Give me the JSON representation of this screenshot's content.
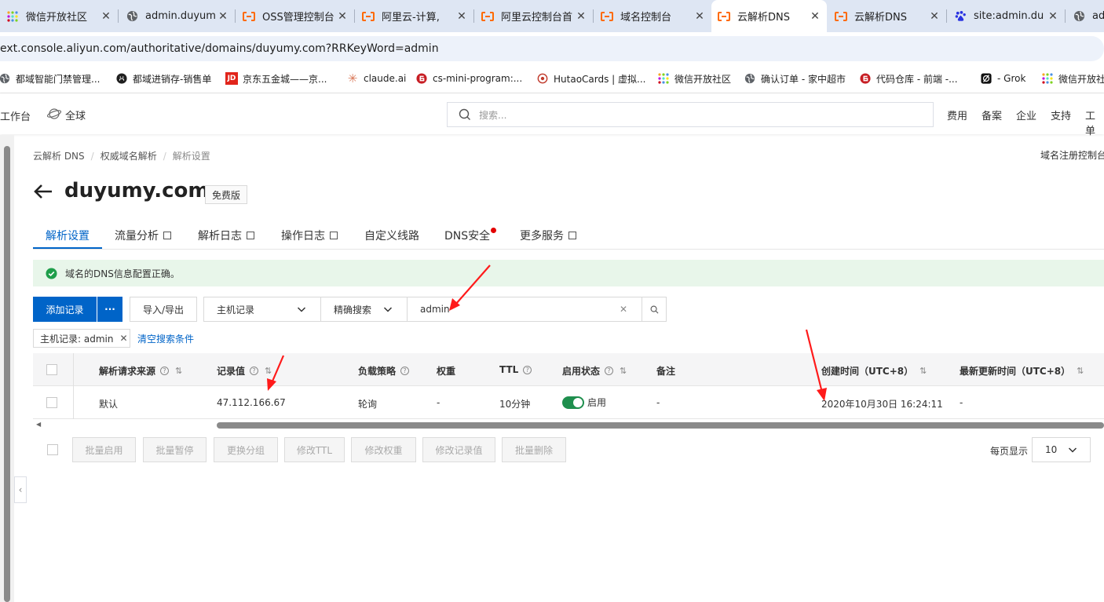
{
  "browser": {
    "tabs": [
      {
        "label": "微信开放社区",
        "icon": "wechat-dots-icon"
      },
      {
        "label": "admin.duyum",
        "icon": "globe-icon"
      },
      {
        "label": "OSS管理控制台",
        "icon": "aliyun-icon"
      },
      {
        "label": "阿里云-计算,",
        "icon": "aliyun-icon"
      },
      {
        "label": "阿里云控制台首",
        "icon": "aliyun-icon"
      },
      {
        "label": "域名控制台",
        "icon": "aliyun-icon"
      },
      {
        "label": "云解析DNS",
        "icon": "aliyun-icon"
      },
      {
        "label": "云解析DNS",
        "icon": "aliyun-icon"
      },
      {
        "label": "site:admin.du",
        "icon": "baidu-icon"
      },
      {
        "label": "ad",
        "icon": "globe-icon"
      }
    ],
    "url": "ext.console.aliyun.com/authoritative/domains/duyumy.com?RRKeyWord=admin",
    "bookmarks": [
      {
        "label": "都域智能门禁管理...",
        "icon": "globe-icon"
      },
      {
        "label": "都域进销存-销售单",
        "icon": "github-icon"
      },
      {
        "label": "京东五金城——京...",
        "icon": "jd-icon"
      },
      {
        "label": "claude.ai",
        "icon": "claude-icon"
      },
      {
        "label": "cs-mini-program:...",
        "icon": "gitee-icon"
      },
      {
        "label": "HutaoCards | 虚拟...",
        "icon": "target-icon"
      },
      {
        "label": "微信开放社区",
        "icon": "wechat-dots-icon"
      },
      {
        "label": "确认订单 - 家中超市",
        "icon": "globe-icon"
      },
      {
        "label": "代码仓库 - 前端 -...",
        "icon": "gitee-icon"
      },
      {
        "label": "- Grok",
        "icon": "grok-icon"
      },
      {
        "label": "微信开放社",
        "icon": "wechat-dots-icon"
      }
    ]
  },
  "topbar": {
    "workbench": "工作台",
    "region": "全球",
    "search_placeholder": "搜索...",
    "links": [
      "费用",
      "备案",
      "企业",
      "支持",
      "工单"
    ]
  },
  "breadcrumb": [
    "云解析 DNS",
    "权威域名解析",
    "解析设置"
  ],
  "right_link": "域名注册控制台",
  "domain": "duyumy.com",
  "edition": "免费版",
  "page_tabs": [
    {
      "label": "解析设置",
      "active": true,
      "external": false
    },
    {
      "label": "流量分析",
      "active": false,
      "external": true
    },
    {
      "label": "解析日志",
      "active": false,
      "external": true
    },
    {
      "label": "操作日志",
      "active": false,
      "external": true
    },
    {
      "label": "自定义线路",
      "active": false,
      "external": false
    },
    {
      "label": "DNS安全",
      "active": false,
      "external": false,
      "dot": true
    },
    {
      "label": "更多服务",
      "active": false,
      "external": true
    }
  ],
  "alert": "域名的DNS信息配置正确。",
  "toolbar": {
    "add_record": "添加记录",
    "more": "···",
    "import_export": "导入/导出",
    "field_select": "主机记录",
    "mode_select": "精确搜索",
    "search_value": "admin"
  },
  "filter": {
    "tag": "主机记录: admin",
    "clear": "清空搜索条件"
  },
  "table": {
    "headers": [
      "解析请求来源",
      "记录值",
      "负载策略",
      "权重",
      "TTL",
      "启用状态",
      "备注",
      "创建时间（UTC+8）",
      "最新更新时间（UTC+8）"
    ],
    "rows": [
      {
        "source": "默认",
        "value": "47.112.166.67",
        "policy": "轮询",
        "weight": "-",
        "ttl": "10分钟",
        "status": "启用",
        "enabled": true,
        "remark": "-",
        "created": "2020年10月30日 16:24:11",
        "updated": "-"
      }
    ]
  },
  "batch_buttons": [
    "批量启用",
    "批量暂停",
    "更换分组",
    "修改TTL",
    "修改权重",
    "修改记录值",
    "批量删除"
  ],
  "pagination": {
    "per_page_label": "每页显示",
    "per_page": "10"
  },
  "colors": {
    "primary": "#0064c8",
    "success": "#1f8f4e",
    "annotation": "#ff1a1a",
    "alert_bg": "#e8f6ea"
  }
}
